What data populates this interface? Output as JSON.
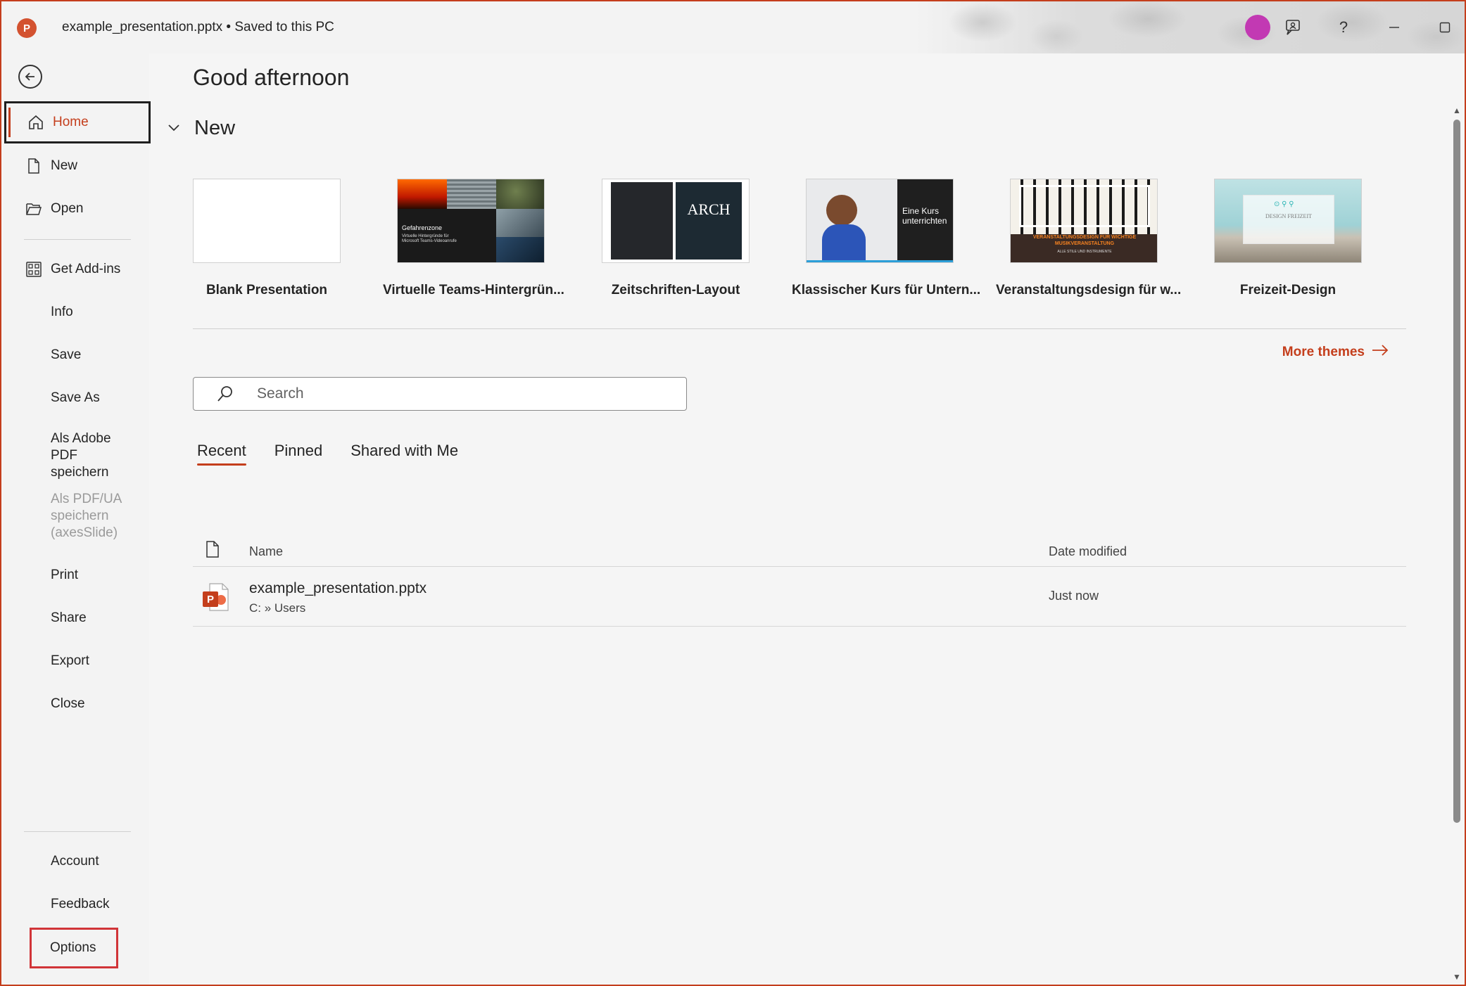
{
  "titlebar": {
    "app_logo_letter": "P",
    "document_title": "example_presentation.pptx • Saved to this PC",
    "avatar_color": "#c239b3",
    "icons": [
      "feedback-icon",
      "help-icon",
      "minimize-icon",
      "maximize-icon",
      "close-icon"
    ],
    "help_glyph": "?"
  },
  "sidebar": {
    "items": [
      {
        "label": "Home",
        "icon": "home-icon",
        "active": true
      },
      {
        "label": "New",
        "icon": "new-document-icon"
      },
      {
        "label": "Open",
        "icon": "folder-open-icon"
      },
      {
        "label": "Get Add-ins",
        "icon": "add-ins-icon"
      },
      {
        "label": "Info"
      },
      {
        "label": "Save"
      },
      {
        "label": "Save As"
      },
      {
        "label": "Als Adobe PDF speichern"
      },
      {
        "label": "Als PDF/UA speichern (axesSlide)",
        "disabled": true
      },
      {
        "label": "Print"
      },
      {
        "label": "Share"
      },
      {
        "label": "Export"
      },
      {
        "label": "Close"
      }
    ],
    "bottom_items": [
      {
        "label": "Account"
      },
      {
        "label": "Feedback"
      },
      {
        "label": "Options",
        "highlighted": true
      }
    ]
  },
  "main": {
    "greeting": "Good afternoon",
    "new_section_label": "New",
    "templates": [
      {
        "label": "Blank Presentation"
      },
      {
        "label": "Virtuelle Teams-Hintergrün...",
        "thumb_title": "Gefahrenzone",
        "thumb_sub": "Virtuelle Hintergründe für Microsoft Teams-Videoanrufe"
      },
      {
        "label": "Zeitschriften-Layout",
        "thumb_title": "ARCH"
      },
      {
        "label": "Klassischer Kurs für Untern...",
        "thumb_title": "Eine Kurs unterrichten"
      },
      {
        "label": "Veranstaltungsdesign für w...",
        "thumb_title": "VERANSTALTUNGSDESIGN FÜR WICHTIGE MUSIKVERANSTALTUNG",
        "thumb_sub": "ALLE STILE UND INSTRUMENTE"
      },
      {
        "label": "Freizeit-Design",
        "thumb_title": "DESIGN FREIZEIT"
      }
    ],
    "more_themes": "More themes",
    "search_placeholder": "Search",
    "tabs": [
      {
        "label": "Recent",
        "active": true
      },
      {
        "label": "Pinned"
      },
      {
        "label": "Shared with Me"
      }
    ],
    "file_list": {
      "columns": [
        "Name",
        "Date modified"
      ],
      "rows": [
        {
          "name": "example_presentation.pptx",
          "path": "C: » Users",
          "date": "Just now"
        }
      ]
    }
  },
  "colors": {
    "accent": "#c43e1c",
    "options_highlight": "#d13438"
  }
}
